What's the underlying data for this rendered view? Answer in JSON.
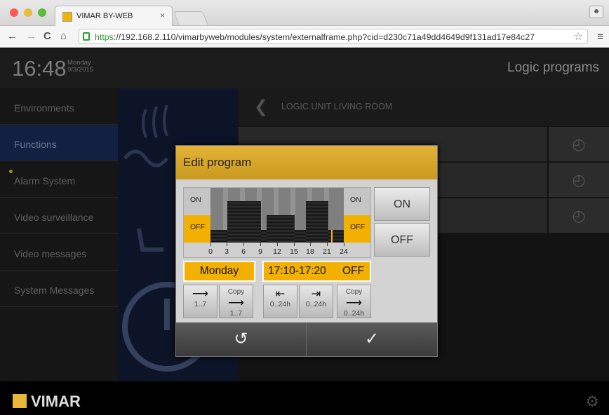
{
  "browser": {
    "tab_title": "VIMAR BY-WEB",
    "tab_close": "×",
    "url_scheme": "https",
    "url_rest": "://192.168.2.110/vimarbyweb/modules/system/externalframe.php?cid=d230c71a49dd4649d9f131ad17e84c27",
    "colors": {
      "close": "#fc5b57",
      "min": "#e5bf3c",
      "max": "#57c038"
    }
  },
  "header": {
    "time": "16:48",
    "day": "Monday",
    "date": "9/3/2015",
    "page_title": "Logic programs"
  },
  "sidebar": {
    "items": [
      {
        "label": "Environments"
      },
      {
        "label": "Functions"
      },
      {
        "label": "Alarm System"
      },
      {
        "label": "Video surveillance"
      },
      {
        "label": "Video messages"
      },
      {
        "label": "System Messages"
      }
    ]
  },
  "panel": {
    "title": "LOGIC UNIT LIVING ROOM"
  },
  "dialog": {
    "title": "Edit program",
    "graph": {
      "on_label": "ON",
      "off_label": "OFF",
      "ticks": [
        "0",
        "3",
        "6",
        "9",
        "12",
        "15",
        "18",
        "21",
        "24"
      ]
    },
    "on_button": "ON",
    "off_button": "OFF",
    "day": "Monday",
    "interval": "17:10-17:20",
    "interval_state": "OFF",
    "tools": [
      {
        "top": "",
        "label": "1..7"
      },
      {
        "top": "Copy",
        "label": "1..7"
      },
      {
        "top": "",
        "label": "0..24h"
      },
      {
        "top": "",
        "label": "0..24h"
      },
      {
        "top": "Copy",
        "label": "0..24h"
      }
    ]
  },
  "footer": {
    "logo": "VIMAR"
  },
  "colors": {
    "accent": "#f2b100",
    "active_item": "#122041"
  }
}
